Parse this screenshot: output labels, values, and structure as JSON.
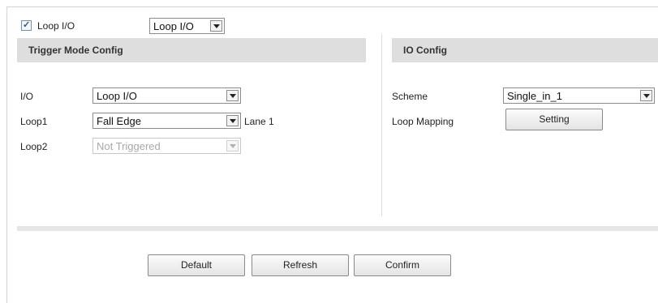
{
  "top": {
    "loop_io_checkbox_label": "Loop I/O",
    "loop_io_checked": true,
    "mode_select_value": "Loop I/O"
  },
  "trigger": {
    "title": "Trigger Mode Config",
    "io_label": "I/O",
    "io_value": "Loop I/O",
    "loop1_label": "Loop1",
    "loop1_value": "Fall Edge",
    "loop1_lane": "Lane 1",
    "loop2_label": "Loop2",
    "loop2_value": "Not Triggered"
  },
  "io": {
    "title": "IO Config",
    "scheme_label": "Scheme",
    "scheme_value": "Single_in_1",
    "loop_mapping_label": "Loop Mapping",
    "setting_button": "Setting"
  },
  "footer": {
    "default_button": "Default",
    "refresh_button": "Refresh",
    "confirm_button": "Confirm"
  }
}
